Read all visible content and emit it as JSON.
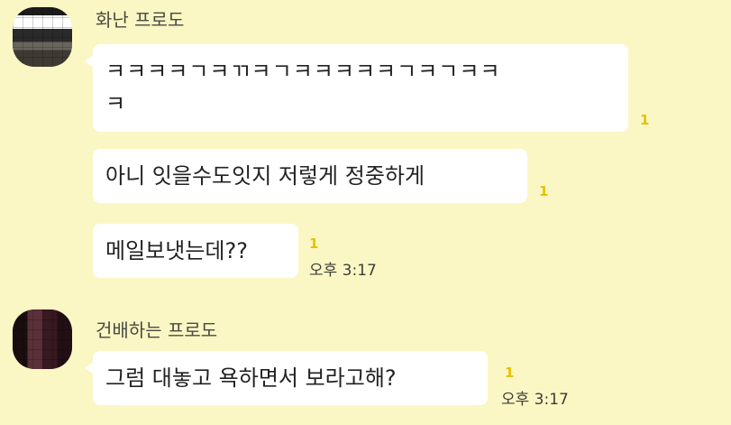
{
  "chat": {
    "groups": [
      {
        "sender": "화난 프로도",
        "avatar_icon": "blurred-profile-avatar",
        "messages": [
          {
            "lines": [
              "ㅋㅋㅋㅋㄱㅋㄲㅋㄱㅋㅋㅋㅋㅋㄱㅋㄱㅋㅋ",
              "ㅋ"
            ],
            "unread": "1"
          },
          {
            "text": "아니 잇을수도잇지 저렇게 정중하게",
            "unread": "1"
          },
          {
            "text": "메일보냇는데??",
            "unread": "1",
            "time": "오후 3:17"
          }
        ]
      },
      {
        "sender": "건배하는 프로도",
        "avatar_icon": "blurred-profile-avatar",
        "messages": [
          {
            "text": "그럼 대놓고 욕하면서 보라고해?",
            "unread": "1",
            "time": "오후 3:17"
          }
        ]
      }
    ]
  },
  "colors": {
    "background": "#fbf7c4",
    "bubble": "#ffffff",
    "unread": "#e8c000"
  }
}
